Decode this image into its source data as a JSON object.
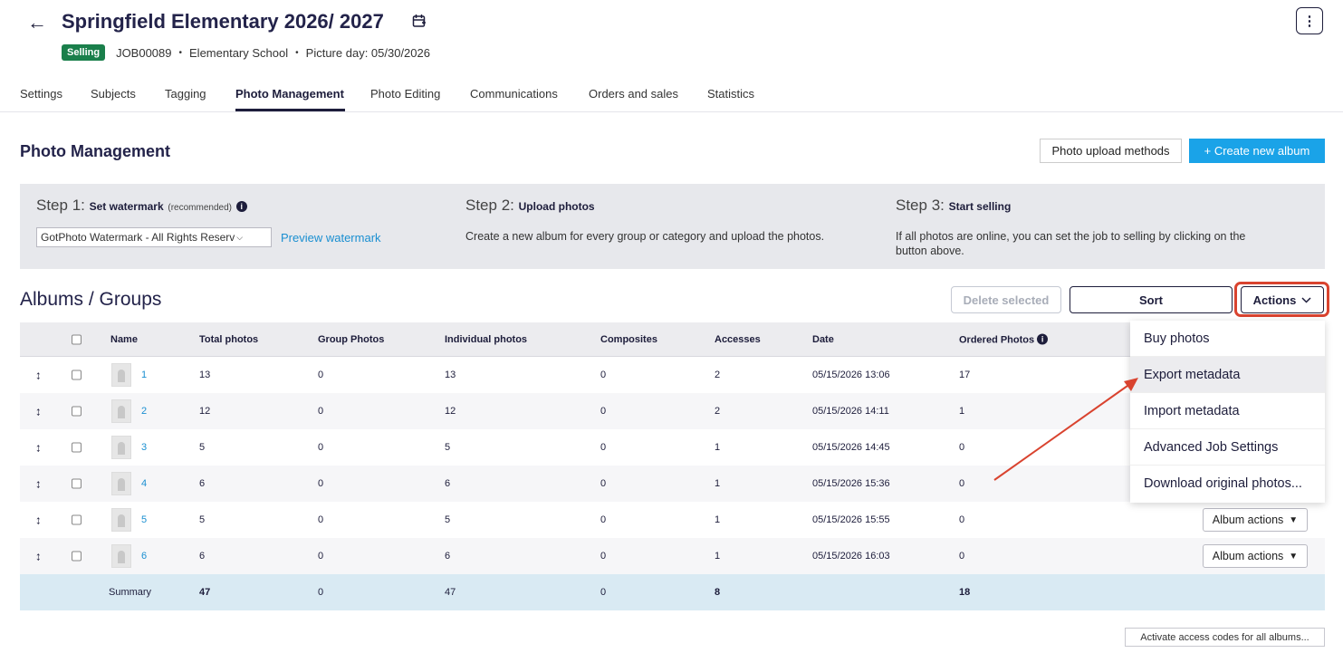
{
  "header": {
    "title": "Springfield Elementary 2026/ 2027",
    "status_badge": "Selling",
    "job_id": "JOB00089",
    "school_type": "Elementary School",
    "picture_day": "Picture day: 05/30/2026"
  },
  "tabs": [
    {
      "label": "Settings",
      "active": false
    },
    {
      "label": "Subjects",
      "active": false
    },
    {
      "label": "Tagging",
      "active": false
    },
    {
      "label": "Photo Management",
      "active": true
    },
    {
      "label": "Photo Editing",
      "active": false
    },
    {
      "label": "Communications",
      "active": false
    },
    {
      "label": "Orders and sales",
      "active": false
    },
    {
      "label": "Statistics",
      "active": false
    }
  ],
  "page": {
    "title": "Photo Management",
    "upload_methods_label": "Photo upload methods",
    "create_album_label": "+ Create new album"
  },
  "steps": {
    "step1": {
      "prefix": "Step 1:",
      "title": "Set watermark",
      "note": "(recommended)",
      "select_value": "GotPhoto Watermark - All Rights Reserv",
      "preview_link": "Preview watermark"
    },
    "step2": {
      "prefix": "Step 2:",
      "title": "Upload photos",
      "text": "Create a new album for every group or category and upload the photos."
    },
    "step3": {
      "prefix": "Step 3:",
      "title": "Start selling",
      "text_line1": "If all photos are online, you can set the job to selling by clicking on the",
      "text_line2": "button above."
    }
  },
  "albums": {
    "title": "Albums / Groups",
    "delete_label": "Delete selected",
    "sort_label": "Sort",
    "actions_label": "Actions",
    "columns": [
      "Name",
      "Total photos",
      "Group Photos",
      "Individual photos",
      "Composites",
      "Accesses",
      "Date",
      "Ordered Photos"
    ],
    "rows": [
      {
        "name": "1",
        "total": "13",
        "group": "0",
        "individual": "13",
        "composites": "0",
        "accesses": "2",
        "date": "05/15/2026 13:06",
        "ordered": "17"
      },
      {
        "name": "2",
        "total": "12",
        "group": "0",
        "individual": "12",
        "composites": "0",
        "accesses": "2",
        "date": "05/15/2026 14:11",
        "ordered": "1"
      },
      {
        "name": "3",
        "total": "5",
        "group": "0",
        "individual": "5",
        "composites": "0",
        "accesses": "1",
        "date": "05/15/2026 14:45",
        "ordered": "0"
      },
      {
        "name": "4",
        "total": "6",
        "group": "0",
        "individual": "6",
        "composites": "0",
        "accesses": "1",
        "date": "05/15/2026 15:36",
        "ordered": "0"
      },
      {
        "name": "5",
        "total": "5",
        "group": "0",
        "individual": "5",
        "composites": "0",
        "accesses": "1",
        "date": "05/15/2026 15:55",
        "ordered": "0"
      },
      {
        "name": "6",
        "total": "6",
        "group": "0",
        "individual": "6",
        "composites": "0",
        "accesses": "1",
        "date": "05/15/2026 16:03",
        "ordered": "0"
      }
    ],
    "album_actions_label": "Album actions",
    "summary": {
      "label": "Summary",
      "total": "47",
      "group": "0",
      "individual": "47",
      "composites": "0",
      "accesses": "8",
      "ordered": "18"
    },
    "activate_label": "Activate access codes for all albums..."
  },
  "actions_menu": {
    "items": [
      "Buy photos",
      "Export metadata",
      "Import metadata",
      "Advanced Job Settings",
      "Download original photos..."
    ],
    "hovered": "Export metadata"
  },
  "colors": {
    "accent": "#1aa3e8",
    "badge": "#1a7f4b",
    "annotation": "#d9432f",
    "link": "#1a8fd1"
  }
}
